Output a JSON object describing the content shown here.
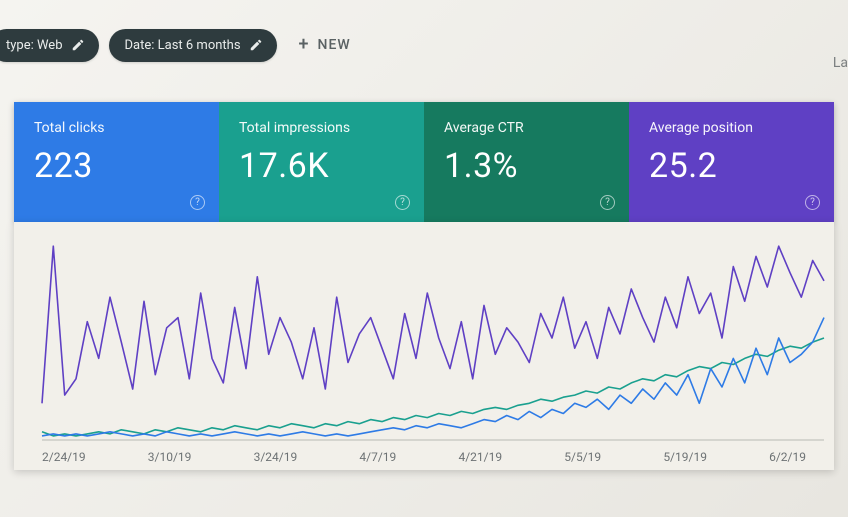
{
  "toolbar": {
    "chips": [
      {
        "label": "type: Web"
      },
      {
        "label": "Date: Last 6 months"
      }
    ],
    "new_label": "NEW"
  },
  "rightcut_text": "La",
  "metrics": [
    {
      "label": "Total clicks",
      "value": "223"
    },
    {
      "label": "Total impressions",
      "value": "17.6K"
    },
    {
      "label": "Average CTR",
      "value": "1.3%"
    },
    {
      "label": "Average position",
      "value": "25.2"
    }
  ],
  "chart_data": {
    "type": "line",
    "xlabel": "",
    "ylabel": "",
    "x_ticks": [
      "2/24/19",
      "3/10/19",
      "3/24/19",
      "4/7/19",
      "4/21/19",
      "5/5/19",
      "5/19/19",
      "6/2/19"
    ],
    "ylim_estimate": [
      0,
      100
    ],
    "series": [
      {
        "name": "Average position",
        "color": "#5f40c4",
        "values": [
          18,
          95,
          22,
          30,
          58,
          40,
          70,
          48,
          25,
          68,
          32,
          55,
          60,
          30,
          72,
          40,
          28,
          65,
          35,
          80,
          42,
          60,
          48,
          30,
          55,
          25,
          70,
          38,
          52,
          60,
          45,
          30,
          62,
          40,
          72,
          50,
          35,
          58,
          30,
          66,
          42,
          55,
          48,
          38,
          62,
          50,
          70,
          45,
          58,
          40,
          65,
          52,
          74,
          60,
          48,
          70,
          55,
          80,
          62,
          72,
          50,
          85,
          68,
          90,
          75,
          95,
          82,
          70,
          88,
          78
        ]
      },
      {
        "name": "Total impressions",
        "color": "#1aa08f",
        "values": [
          4,
          2,
          3,
          2,
          3,
          4,
          3,
          5,
          4,
          3,
          5,
          4,
          6,
          5,
          4,
          6,
          5,
          7,
          6,
          5,
          7,
          6,
          8,
          7,
          6,
          8,
          7,
          9,
          8,
          10,
          9,
          11,
          10,
          12,
          11,
          13,
          12,
          14,
          13,
          15,
          16,
          15,
          17,
          18,
          20,
          19,
          21,
          22,
          24,
          23,
          26,
          25,
          28,
          30,
          29,
          32,
          31,
          34,
          36,
          35,
          38,
          37,
          40,
          42,
          41,
          44,
          46,
          45,
          48,
          50
        ]
      },
      {
        "name": "Total clicks",
        "color": "#2e7be6",
        "values": [
          2,
          3,
          2,
          3,
          2,
          3,
          4,
          3,
          2,
          3,
          2,
          4,
          3,
          2,
          3,
          2,
          3,
          4,
          3,
          2,
          3,
          2,
          3,
          4,
          3,
          2,
          3,
          2,
          3,
          4,
          5,
          6,
          5,
          7,
          6,
          8,
          7,
          6,
          8,
          10,
          9,
          12,
          10,
          14,
          11,
          15,
          13,
          18,
          16,
          20,
          15,
          22,
          18,
          25,
          20,
          28,
          22,
          32,
          18,
          35,
          26,
          40,
          28,
          45,
          32,
          50,
          38,
          42,
          48,
          60
        ]
      }
    ]
  }
}
